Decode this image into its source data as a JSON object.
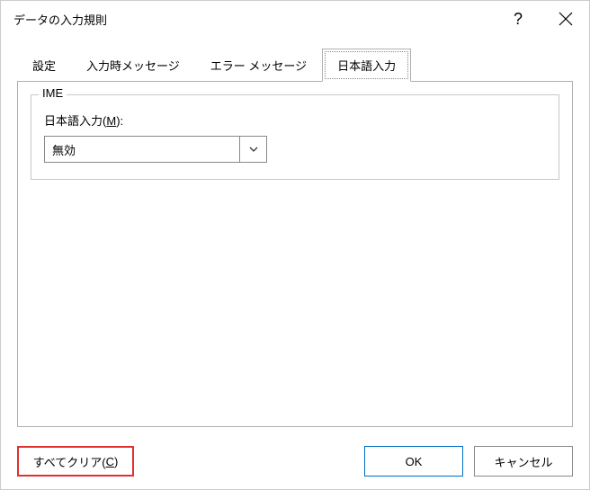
{
  "titlebar": {
    "title": "データの入力規則",
    "help": "?"
  },
  "tabs": {
    "settings": "設定",
    "input_msg": "入力時メッセージ",
    "error_msg": "エラー メッセージ",
    "ime": "日本語入力"
  },
  "fieldset": {
    "legend": "IME",
    "label_pre": "日本語入力(",
    "label_key": "M",
    "label_post": "):",
    "dropdown_value": "無効"
  },
  "buttons": {
    "clear_pre": "すべてクリア(",
    "clear_key": "C",
    "clear_post": ")",
    "ok": "OK",
    "cancel": "キャンセル"
  }
}
